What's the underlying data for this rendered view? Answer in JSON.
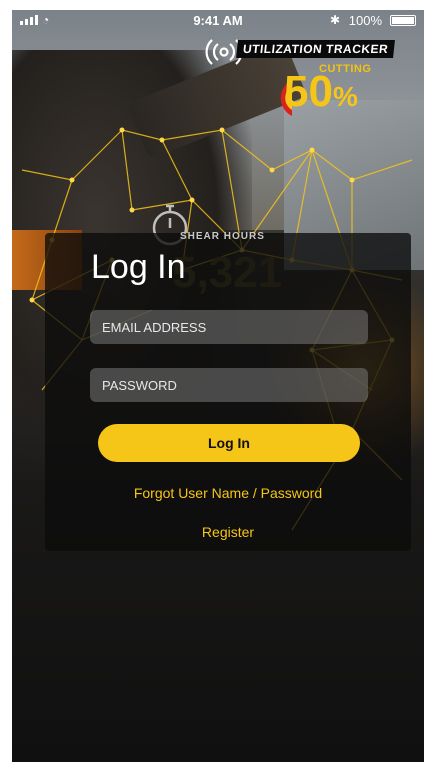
{
  "status_bar": {
    "time": "9:41 AM",
    "battery": "100%",
    "wifi_icon": "wifi-icon",
    "bluetooth_icon": "bluetooth-icon"
  },
  "graphic": {
    "tracker_title": "UTILIZATION TRACKER",
    "cutting_label": "CUTTING",
    "cutting_value": "50",
    "cutting_unit": "%",
    "shear_label": "SHEAR HOURS",
    "shear_value": "5,321"
  },
  "login": {
    "title": "Log In",
    "email_placeholder": "EMAIL ADDRESS",
    "password_placeholder": "PASSWORD",
    "button_label": "Log In",
    "forgot_link": "Forgot User Name / Password",
    "register_link": "Register"
  },
  "colors": {
    "accent": "#f5c518",
    "panel": "#0c0c0c",
    "field": "#787878"
  }
}
